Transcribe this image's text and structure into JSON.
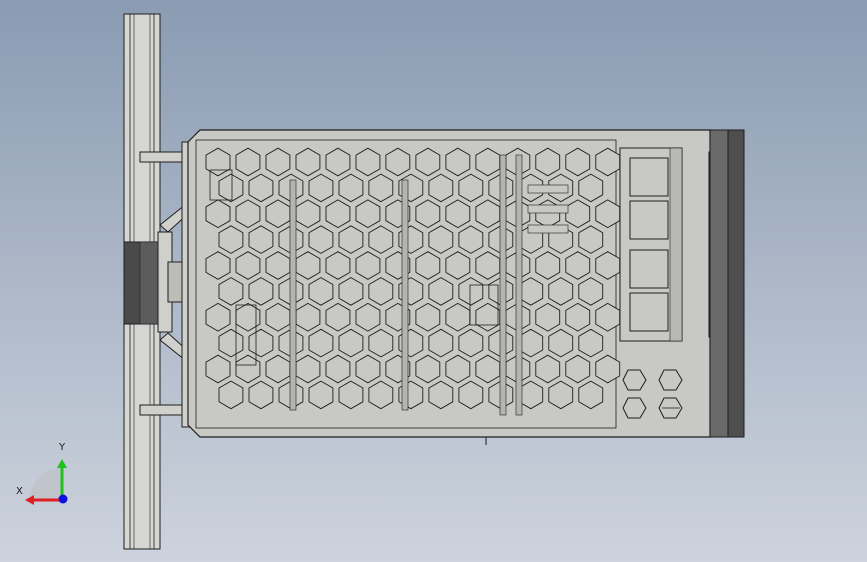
{
  "app": {
    "view": "cad-graphics-viewport"
  },
  "model": {
    "parts": [
      "din-rail",
      "mounting-bracket",
      "ventilated-housing",
      "terminal-block",
      "front-plate"
    ],
    "colors": {
      "background_top": "#8a9bb2",
      "background_bottom": "#cdd3dd",
      "part_face": "#c8c8c4",
      "edge": "#1e1e1e",
      "plate_dark": "#5e5e5e",
      "rail_face": "#d6d6d2"
    }
  },
  "triad": {
    "x_label": "X",
    "y_label": "Y",
    "x_color": "#e02020",
    "y_color": "#20c020",
    "z_color": "#1010e0"
  }
}
